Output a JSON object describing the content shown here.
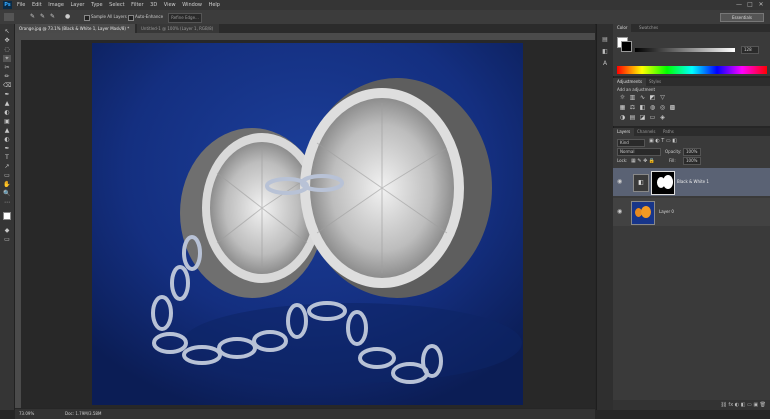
{
  "app": {
    "logo": "Ps",
    "accent": "#31a8ff"
  },
  "menu": [
    "File",
    "Edit",
    "Image",
    "Layer",
    "Type",
    "Select",
    "Filter",
    "3D",
    "View",
    "Window",
    "Help"
  ],
  "window_controls": [
    "—",
    "□",
    "✕"
  ],
  "options_bar": {
    "checkbox1_label": "Sample All Layers",
    "checkbox2_label": "Auto-Enhance",
    "refine_label": "Refine Edge...",
    "workspace": "Essentials"
  },
  "document_tabs": [
    {
      "label": "Orange.jpg @ 73.1% (Black & White 1, Layer Mask/8) *",
      "active": true
    },
    {
      "label": "Untitled-1 @ 100% (Layer 1, RGB/8)",
      "active": false
    }
  ],
  "statusbar": {
    "zoom": "73.09%",
    "doc": "Doc: 1.79M/3.58M"
  },
  "tools": [
    "↖",
    "✥",
    "◌",
    "⌖",
    "✂",
    "✏",
    "⌫",
    "✒",
    "▲",
    "◐",
    "▣",
    "T",
    "↗",
    "▭",
    "✋",
    "🔍",
    "⋯",
    "◆"
  ],
  "panels": {
    "color": {
      "tabs": [
        "Color",
        "Swatches"
      ],
      "value": "128"
    },
    "adjustments": {
      "tabs": [
        "Adjustments",
        "Styles"
      ],
      "add_label": "Add an adjustment"
    },
    "layers": {
      "tabs": [
        "Layers",
        "Channels",
        "Paths"
      ],
      "kind": "Kind",
      "blend": "Normal",
      "opacity_label": "Opacity:",
      "opacity_value": "100%",
      "lock_label": "Lock:",
      "fill_label": "Fill:",
      "fill_value": "100%",
      "items": [
        {
          "name": "Black & White 1",
          "selected": true
        },
        {
          "name": "Layer 0",
          "selected": false
        }
      ]
    }
  }
}
